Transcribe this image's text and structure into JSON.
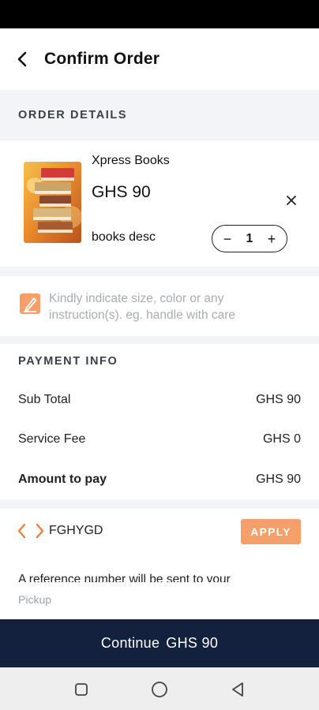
{
  "header": {
    "title": "Confirm Order"
  },
  "order_details": {
    "section_label": "ORDER DETAILS",
    "item": {
      "name": "Xpress Books",
      "price": "GHS 90",
      "description": "books desc",
      "quantity": "1",
      "qty_minus": "−",
      "qty_plus": "+"
    }
  },
  "note": {
    "placeholder": "Kindly indicate size, color or any instruction(s). eg. handle with care"
  },
  "payment": {
    "section_label": "PAYMENT INFO",
    "rows": [
      {
        "label": "Sub Total",
        "value": "GHS 90"
      },
      {
        "label": "Service Fee",
        "value": "GHS 0"
      },
      {
        "label": "Amount to pay",
        "value": "GHS 90"
      }
    ]
  },
  "coupon": {
    "code": "FGHYGD",
    "apply_label": "APPLY"
  },
  "reference_note": "A reference number will be sent to your",
  "delivery_type": "Pickup",
  "continue": {
    "label": "Continue",
    "amount": "GHS 90"
  },
  "colors": {
    "accent": "#f5a06a",
    "primary_dark": "#13213e",
    "section_bg": "#f2f4f8"
  },
  "icons": {
    "back": "arrow-left-icon",
    "remove": "close-icon",
    "note": "edit-icon",
    "coupon": "code-icon",
    "nav_recents": "square-icon",
    "nav_home": "circle-icon",
    "nav_back": "triangle-icon"
  }
}
